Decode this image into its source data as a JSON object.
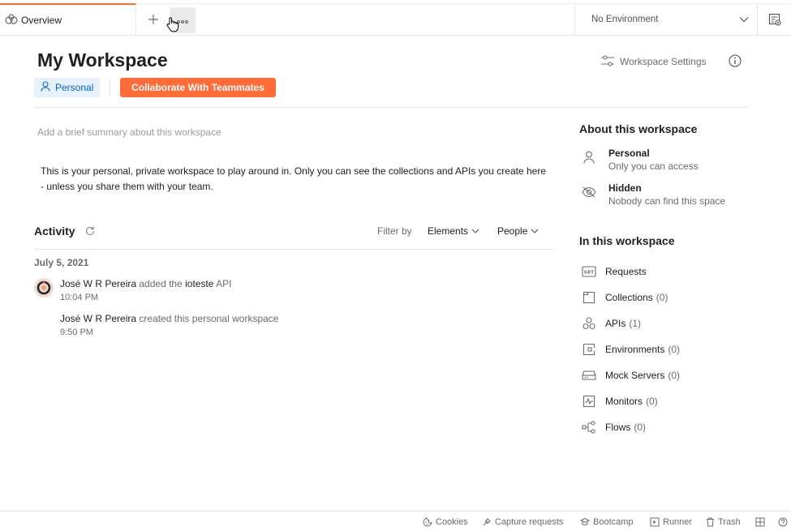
{
  "tabs": {
    "overview_label": "Overview",
    "environment": {
      "selected": "No Environment"
    }
  },
  "header": {
    "title": "My Workspace",
    "badge": "Personal",
    "collaborate_label": "Collaborate With Teammates",
    "settings_label": "Workspace Settings"
  },
  "summary": {
    "placeholder": "Add a brief summary about this workspace",
    "value": ""
  },
  "description": "This is your personal, private workspace to play around in. Only you can see the collections and APIs you create here - unless you share them with your team.",
  "activity": {
    "title": "Activity",
    "filter_by": "Filter by",
    "filters": [
      "Elements",
      "People"
    ],
    "date": "July 5, 2021",
    "entries": [
      {
        "user": "José W R Pereira",
        "action": "added the",
        "target": "ioteste",
        "target_type": "API",
        "time": "10:04 PM"
      },
      {
        "user": "José W R Pereira",
        "action": "created this personal workspace",
        "time": "9:50 PM"
      }
    ]
  },
  "about": {
    "title": "About this workspace",
    "items": [
      {
        "icon": "person-icon",
        "title": "Personal",
        "subtitle": "Only you can access"
      },
      {
        "icon": "eye-off-icon",
        "title": "Hidden",
        "subtitle": "Nobody can find this space"
      }
    ]
  },
  "in_workspace": {
    "title": "In this workspace",
    "items": [
      {
        "icon": "requests-icon",
        "label": "Requests",
        "count": ""
      },
      {
        "icon": "collections-icon",
        "label": "Collections",
        "count": "(0)"
      },
      {
        "icon": "apis-icon",
        "label": "APIs",
        "count": "(1)"
      },
      {
        "icon": "environments-icon",
        "label": "Environments",
        "count": "(0)"
      },
      {
        "icon": "mock-servers-icon",
        "label": "Mock Servers",
        "count": "(0)"
      },
      {
        "icon": "monitors-icon",
        "label": "Monitors",
        "count": "(0)"
      },
      {
        "icon": "flows-icon",
        "label": "Flows",
        "count": "(0)"
      }
    ]
  },
  "statusbar": {
    "cookies": "Cookies",
    "capture": "Capture requests",
    "bootcamp": "Bootcamp",
    "runner": "Runner",
    "trash": "Trash"
  },
  "colors": {
    "accent": "#ff6c37",
    "badge_bg": "#e6f1fc",
    "badge_text": "#0265d2",
    "text_primary": "#212121",
    "text_secondary": "#6b6b6b"
  }
}
